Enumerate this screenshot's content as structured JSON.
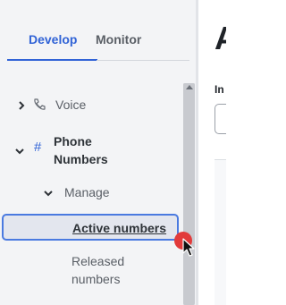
{
  "tabs": {
    "develop": "Develop",
    "monitor": "Monitor"
  },
  "nav": {
    "voice": "Voice",
    "phone_numbers": "Phone Numbers",
    "manage": "Manage",
    "active_numbers": "Active numbers",
    "released_numbers": "Released numbers"
  },
  "main": {
    "title_fragment": "A",
    "label_fragment": "In"
  },
  "icons": {
    "voice": "phone-icon",
    "phone_numbers": "hash-icon",
    "expand": "chevron-right-icon",
    "collapse": "chevron-down-icon"
  },
  "colors": {
    "accent": "#3163d6",
    "active_bg": "#e3e6ee",
    "click_marker": "#e23b3b"
  }
}
